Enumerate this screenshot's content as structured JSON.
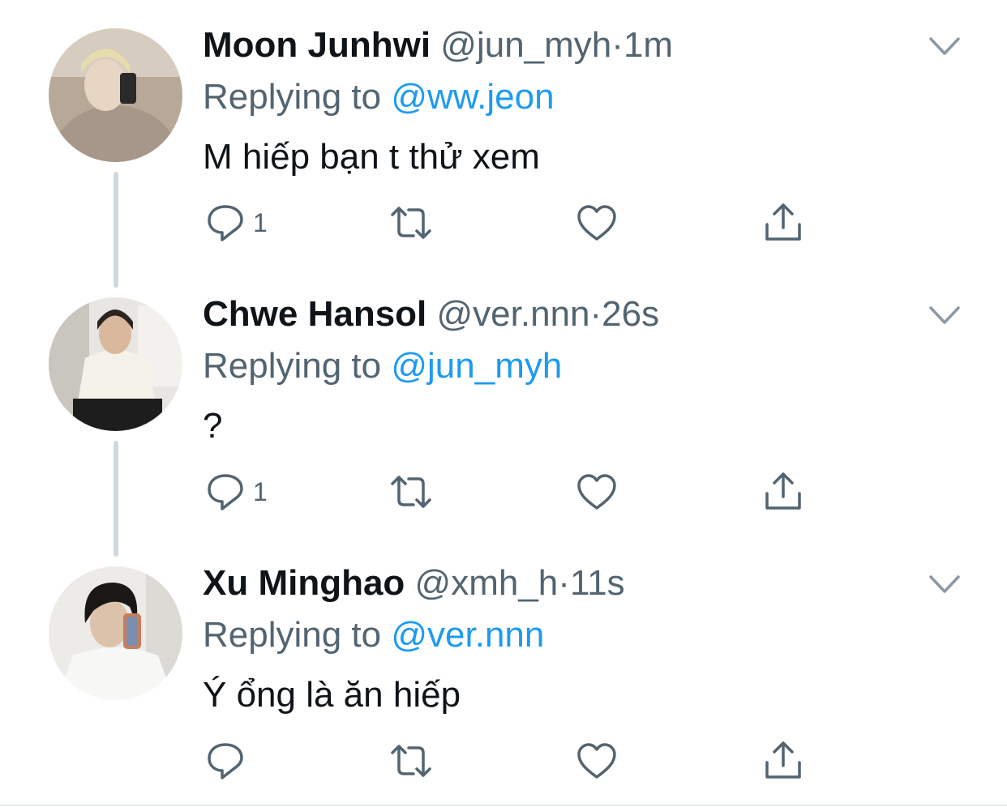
{
  "tweets": [
    {
      "name": "Moon Junhwi",
      "handle": "@jun_myh",
      "dot": "·",
      "time": "1m",
      "reply_prefix": "Replying to ",
      "reply_to": "@ww.jeon",
      "text": "M hiếp bạn t thử xem",
      "reply_count": "1"
    },
    {
      "name": "Chwe Hansol",
      "handle": "@ver.nnn",
      "dot": "·",
      "time": "26s",
      "reply_prefix": "Replying to ",
      "reply_to": "@jun_myh",
      "text": "?",
      "reply_count": "1"
    },
    {
      "name": "Xu Minghao",
      "handle": "@xmh_h",
      "dot": "·",
      "time": "11s",
      "reply_prefix": "Replying to ",
      "reply_to": "@ver.nnn",
      "text": "Ý ổng là ăn hiếp",
      "reply_count": ""
    }
  ],
  "colors": {
    "accent": "#1d9bf0",
    "secondary_text": "#536471",
    "icon": "#536471",
    "thread_line": "#cfd9de"
  },
  "icons": {
    "reply": "reply-bubble-icon",
    "retweet": "retweet-icon",
    "like": "heart-icon",
    "share": "share-icon",
    "more": "chevron-down-icon"
  }
}
